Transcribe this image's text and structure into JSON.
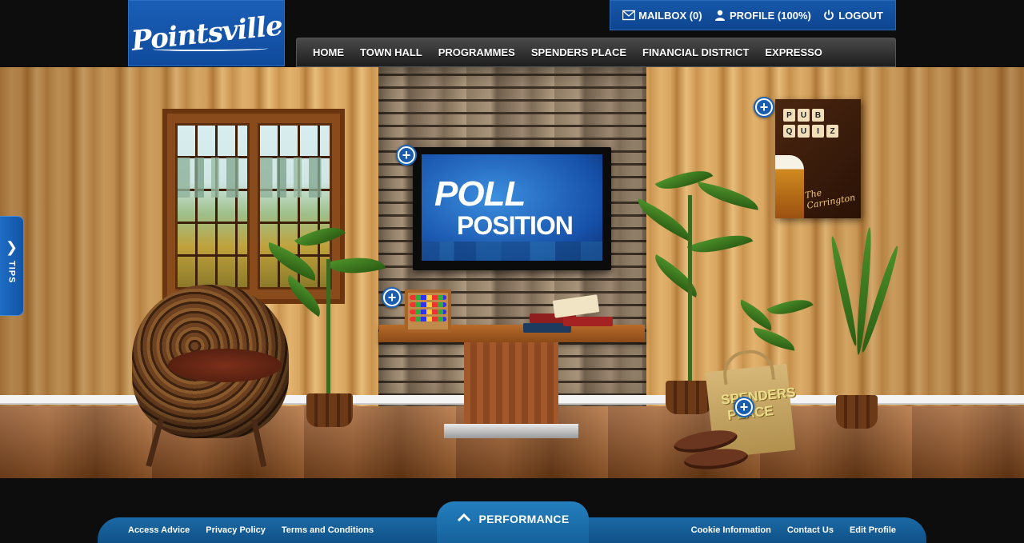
{
  "brand": {
    "logo_text": "Pointsville"
  },
  "userbar": {
    "mailbox": "MAILBOX (0)",
    "profile": "PROFILE (100%)",
    "logout": "LOGOUT"
  },
  "nav": {
    "items": [
      {
        "label": "HOME"
      },
      {
        "label": "TOWN HALL"
      },
      {
        "label": "PROGRAMMES"
      },
      {
        "label": "SPENDERS PLACE"
      },
      {
        "label": "FINANCIAL DISTRICT"
      },
      {
        "label": "EXPRESSO"
      }
    ]
  },
  "scene": {
    "tv": {
      "line1": "POLL",
      "line2": "POSITION"
    },
    "poster": {
      "tiles_row1": [
        "P",
        "U",
        "B"
      ],
      "tiles_row2": [
        "Q",
        "U",
        "I",
        "Z"
      ],
      "venue": "The Carrington"
    },
    "bag": {
      "line1": "SPENDERS",
      "line2": "PLACE"
    },
    "hotspot_symbol": "+"
  },
  "tips": {
    "label": "TIPS",
    "chevron": "❯"
  },
  "footer": {
    "performance_label": "PERFORMANCE",
    "links_left": [
      "Access Advice",
      "Privacy Policy",
      "Terms and Conditions"
    ],
    "links_right": [
      "Cookie Information",
      "Contact Us",
      "Edit Profile"
    ]
  },
  "colors": {
    "brand_blue": "#1658aa",
    "nav_dark": "#2a2a2a",
    "footer_blue": "#15629c"
  }
}
